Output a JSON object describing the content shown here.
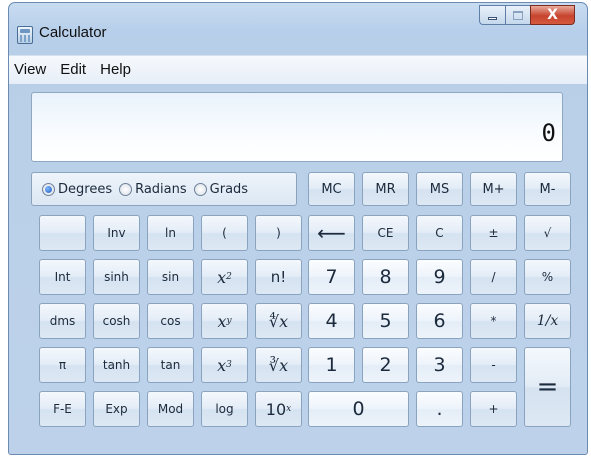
{
  "window": {
    "title": "Calculator",
    "close_glyph": "X"
  },
  "menu": {
    "items": [
      "View",
      "Edit",
      "Help"
    ]
  },
  "display": {
    "value": "0"
  },
  "angle": {
    "options": [
      "Degrees",
      "Radians",
      "Grads"
    ],
    "selected": "Degrees"
  },
  "buttons": {
    "mc": "MC",
    "mr": "MR",
    "ms": "MS",
    "mplus": "M+",
    "mminus": "M-",
    "blank": "",
    "inv": "Inv",
    "ln": "ln",
    "lparen": "(",
    "rparen": ")",
    "backspace": "⟵",
    "ce": "CE",
    "c": "C",
    "plusminus": "±",
    "sqrt": "√",
    "int": "Int",
    "sinh": "sinh",
    "sin": "sin",
    "x2_base": "x",
    "x2_exp": "2",
    "fact": "n!",
    "d7": "7",
    "d8": "8",
    "d9": "9",
    "divide": "/",
    "percent": "%",
    "dms": "dms",
    "cosh": "cosh",
    "cos": "cos",
    "xy_base": "x",
    "xy_exp": "y",
    "yroot": "∜x",
    "d4": "4",
    "d5": "5",
    "d6": "6",
    "multiply": "*",
    "reciprocal": "1/x",
    "pi": "π",
    "tanh": "tanh",
    "tan": "tan",
    "x3_base": "x",
    "x3_exp": "3",
    "cuberoot": "∛x",
    "d1": "1",
    "d2": "2",
    "d3": "3",
    "subtract": "-",
    "equals": "=",
    "fe": "F-E",
    "exp": "Exp",
    "mod": "Mod",
    "log": "log",
    "tenx_base": "10",
    "tenx_exp": "x",
    "d0": "0",
    "decimal": ".",
    "add": "+"
  }
}
